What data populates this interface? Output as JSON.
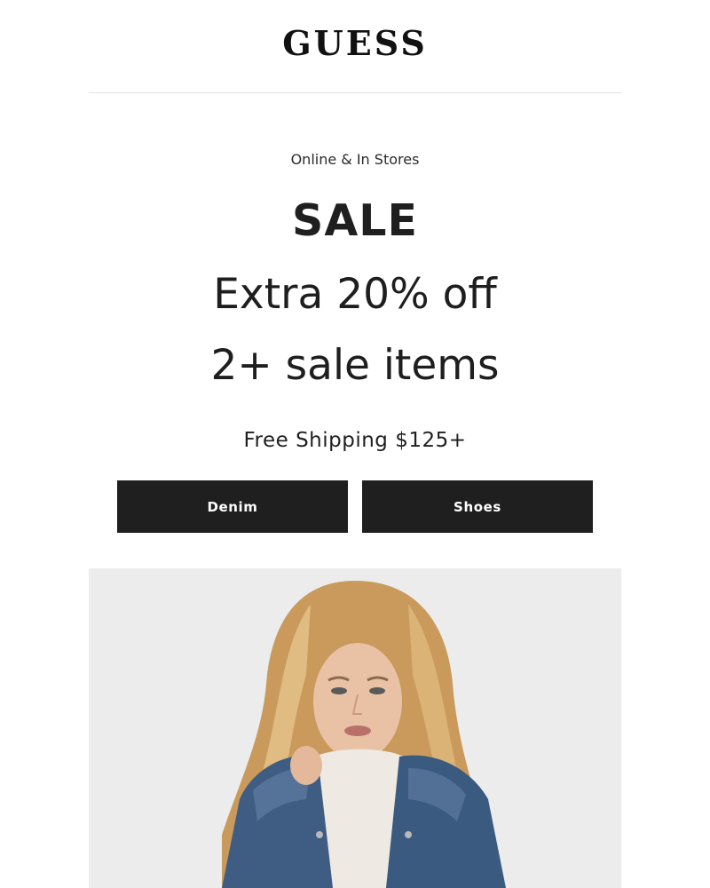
{
  "brand": {
    "logo_text": "GUESS"
  },
  "promo": {
    "eyebrow": "Online & In Stores",
    "title": "SALE",
    "offer_line_1": "Extra 20% off",
    "offer_line_2": "2+ sale items",
    "shipping": "Free Shipping $125+"
  },
  "buttons": {
    "denim_label": "Denim",
    "shoes_label": "Shoes"
  },
  "colors": {
    "button_bg": "#1f1f1f",
    "button_text": "#ffffff",
    "page_bg": "#ffffff",
    "image_bg": "#ececec"
  }
}
